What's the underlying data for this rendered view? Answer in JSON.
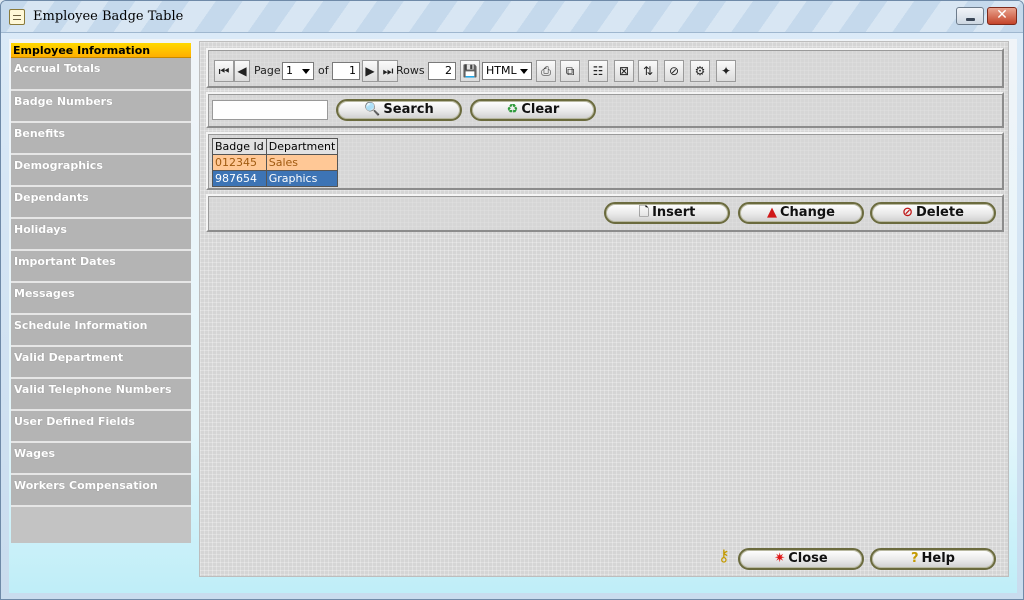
{
  "window": {
    "title": "Employee Badge Table",
    "close_glyph": "✕"
  },
  "sidebar": {
    "header": "Employee Information",
    "items": [
      "Accrual Totals",
      "Badge Numbers",
      "Benefits",
      "Demographics",
      "Dependants",
      "Holidays",
      "Important Dates",
      "Messages",
      "Schedule Information",
      "Valid Department",
      "Valid Telephone Numbers",
      "User Defined Fields",
      "Wages",
      "Workers Compensation"
    ]
  },
  "toolbar": {
    "page_label": "Page",
    "page_value": "1",
    "of_label": "of",
    "total_pages": "1",
    "rows_label": "Rows",
    "rows_value": "2",
    "format_value": "HTML"
  },
  "search": {
    "input_value": "",
    "search_label": "Search",
    "clear_label": "Clear"
  },
  "grid": {
    "columns": [
      "Badge Id",
      "Department"
    ],
    "rows": [
      [
        "012345",
        "Sales"
      ],
      [
        "987654",
        "Graphics"
      ]
    ]
  },
  "actions": {
    "insert_label": "Insert",
    "change_label": "Change",
    "delete_label": "Delete"
  },
  "footer": {
    "close_label": "Close",
    "help_label": "Help"
  }
}
